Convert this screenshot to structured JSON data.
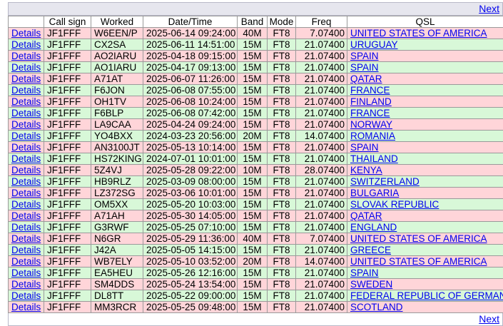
{
  "nav": {
    "next_label": "Next"
  },
  "headers": [
    "",
    "Call sign",
    "Worked",
    "Date/Time",
    "Band",
    "Mode",
    "Freq",
    "QSL"
  ],
  "details_label": "Details",
  "rows": [
    {
      "call": "JF1FFF",
      "worked": "W6EEN/P",
      "datetime": "2025-06-14 09:24:00",
      "band": "40M",
      "mode": "FT8",
      "freq": "7.07400",
      "qsl": "UNITED STATES OF AMERICA",
      "color": "pink"
    },
    {
      "call": "JF1FFF",
      "worked": "CX2SA",
      "datetime": "2025-06-11 14:51:00",
      "band": "15M",
      "mode": "FT8",
      "freq": "21.07400",
      "qsl": "URUGUAY",
      "color": "green"
    },
    {
      "call": "JF1FFF",
      "worked": "AO2IARU",
      "datetime": "2025-04-18 09:15:00",
      "band": "15M",
      "mode": "FT8",
      "freq": "21.07400",
      "qsl": "SPAIN",
      "color": "pink"
    },
    {
      "call": "JF1FFF",
      "worked": "AO1IARU",
      "datetime": "2025-04-17 09:13:00",
      "band": "15M",
      "mode": "FT8",
      "freq": "21.07400",
      "qsl": "SPAIN",
      "color": "green"
    },
    {
      "call": "JF1FFF",
      "worked": "A71AT",
      "datetime": "2025-06-07 11:26:00",
      "band": "15M",
      "mode": "FT8",
      "freq": "21.07400",
      "qsl": "QATAR",
      "color": "pink"
    },
    {
      "call": "JF1FFF",
      "worked": "F6JON",
      "datetime": "2025-06-08 07:55:00",
      "band": "15M",
      "mode": "FT8",
      "freq": "21.07400",
      "qsl": "FRANCE",
      "color": "green"
    },
    {
      "call": "JF1FFF",
      "worked": "OH1TV",
      "datetime": "2025-06-08 10:24:00",
      "band": "15M",
      "mode": "FT8",
      "freq": "21.07400",
      "qsl": "FINLAND",
      "color": "pink"
    },
    {
      "call": "JF1FFF",
      "worked": "F6BLP",
      "datetime": "2025-06-08 07:42:00",
      "band": "15M",
      "mode": "FT8",
      "freq": "21.07400",
      "qsl": "FRANCE",
      "color": "green"
    },
    {
      "call": "JF1FFF",
      "worked": "LA9CAA",
      "datetime": "2025-04-24 09:24:00",
      "band": "15M",
      "mode": "FT8",
      "freq": "21.07400",
      "qsl": "NORWAY",
      "color": "pink"
    },
    {
      "call": "JF1FFF",
      "worked": "YO4BXX",
      "datetime": "2024-03-23 20:56:00",
      "band": "20M",
      "mode": "FT8",
      "freq": "14.07400",
      "qsl": "ROMANIA",
      "color": "green"
    },
    {
      "call": "JF1FFF",
      "worked": "AN3100JT",
      "datetime": "2025-05-13 10:14:00",
      "band": "15M",
      "mode": "FT8",
      "freq": "21.07400",
      "qsl": "SPAIN",
      "color": "pink"
    },
    {
      "call": "JF1FFF",
      "worked": "HS72KING",
      "datetime": "2024-07-01 10:01:00",
      "band": "15M",
      "mode": "FT8",
      "freq": "21.07400",
      "qsl": "THAILAND",
      "color": "green"
    },
    {
      "call": "JF1FFF",
      "worked": "5Z4VJ",
      "datetime": "2025-05-28 09:22:00",
      "band": "10M",
      "mode": "FT8",
      "freq": "28.07400",
      "qsl": "KENYA",
      "color": "pink"
    },
    {
      "call": "JF1FFF",
      "worked": "HB9RLZ",
      "datetime": "2025-03-09 08:00:00",
      "band": "15M",
      "mode": "FT8",
      "freq": "21.07400",
      "qsl": "SWITZERLAND",
      "color": "green"
    },
    {
      "call": "JF1FFF",
      "worked": "LZ372SG",
      "datetime": "2025-03-06 10:01:00",
      "band": "15M",
      "mode": "FT8",
      "freq": "21.07400",
      "qsl": "BULGARIA",
      "color": "pink"
    },
    {
      "call": "JF1FFF",
      "worked": "OM5XX",
      "datetime": "2025-05-20 10:03:00",
      "band": "15M",
      "mode": "FT8",
      "freq": "21.07400",
      "qsl": "SLOVAK REPUBLIC",
      "color": "green"
    },
    {
      "call": "JF1FFF",
      "worked": "A71AH",
      "datetime": "2025-05-30 14:05:00",
      "band": "15M",
      "mode": "FT8",
      "freq": "21.07400",
      "qsl": "QATAR",
      "color": "pink"
    },
    {
      "call": "JF1FFF",
      "worked": "G3RWF",
      "datetime": "2025-05-25 07:10:00",
      "band": "15M",
      "mode": "FT8",
      "freq": "21.07400",
      "qsl": "ENGLAND",
      "color": "green"
    },
    {
      "call": "JF1FFF",
      "worked": "N6GR",
      "datetime": "2025-05-29 11:36:00",
      "band": "40M",
      "mode": "FT8",
      "freq": "7.07400",
      "qsl": "UNITED STATES OF AMERICA",
      "color": "pink"
    },
    {
      "call": "JF1FFF",
      "worked": "J42A",
      "datetime": "2025-05-05 14:15:00",
      "band": "15M",
      "mode": "FT8",
      "freq": "21.07400",
      "qsl": "GREECE",
      "color": "green"
    },
    {
      "call": "JF1FFF",
      "worked": "WB7ELY",
      "datetime": "2025-05-10 03:52:00",
      "band": "20M",
      "mode": "FT8",
      "freq": "14.07400",
      "qsl": "UNITED STATES OF AMERICA",
      "color": "pink"
    },
    {
      "call": "JF1FFF",
      "worked": "EA5HEU",
      "datetime": "2025-05-26 12:16:00",
      "band": "15M",
      "mode": "FT8",
      "freq": "21.07400",
      "qsl": "SPAIN",
      "color": "green"
    },
    {
      "call": "JF1FFF",
      "worked": "SM4DDS",
      "datetime": "2025-05-24 13:54:00",
      "band": "15M",
      "mode": "FT8",
      "freq": "21.07400",
      "qsl": "SWEDEN",
      "color": "pink"
    },
    {
      "call": "JF1FFF",
      "worked": "DL8TT",
      "datetime": "2025-05-22 09:00:00",
      "band": "15M",
      "mode": "FT8",
      "freq": "21.07400",
      "qsl": "FEDERAL REPUBLIC OF GERMANY",
      "color": "green"
    },
    {
      "call": "JF1FFF",
      "worked": "MM3RCR",
      "datetime": "2025-05-25 09:48:00",
      "band": "15M",
      "mode": "FT8",
      "freq": "21.07400",
      "qsl": "SCOTLAND",
      "color": "pink"
    }
  ],
  "colors": {
    "pink_row": "#ffd5d9",
    "green_row": "#d8f8d8",
    "link": "#0000ee"
  }
}
